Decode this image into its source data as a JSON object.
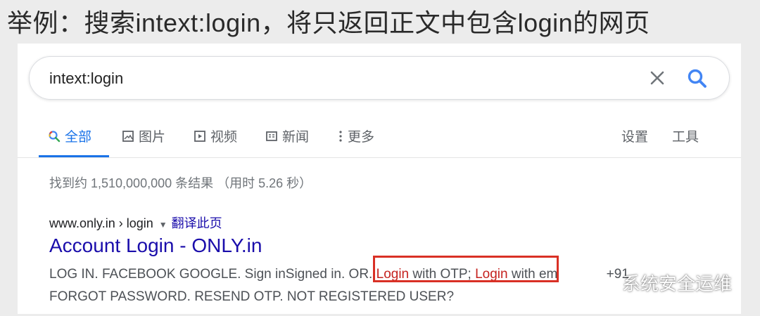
{
  "caption": "举例：搜索intext:login，将只返回正文中包含login的网页",
  "search": {
    "value": "intext:login"
  },
  "tabs": {
    "all": "全部",
    "images": "图片",
    "videos": "视频",
    "news": "新闻",
    "more": "更多",
    "settings": "设置",
    "tools": "工具"
  },
  "stats": "找到约 1,510,000,000 条结果 （用时 5.26 秒）",
  "result": {
    "cite_domain": "www.only.in",
    "cite_sep": " › ",
    "cite_path": "login",
    "translate": "翻译此页",
    "title": "Account Login - ONLY.in",
    "snippet1_a": "LOG IN. FACEBOOK GOOGLE. Sign inSigned in. OR. ",
    "snippet1_hl1": "Login",
    "snippet1_b": " with OTP; ",
    "snippet1_hl2": "Login",
    "snippet1_c": " with em",
    "snippet1_d": " +91",
    "snippet2": "FORGOT PASSWORD. RESEND OTP. NOT REGISTERED USER?"
  },
  "watermark": "系统安全运维",
  "colors": {
    "accent": "#1a73e8",
    "link": "#1a0dab",
    "highlight_box": "#d93025"
  }
}
